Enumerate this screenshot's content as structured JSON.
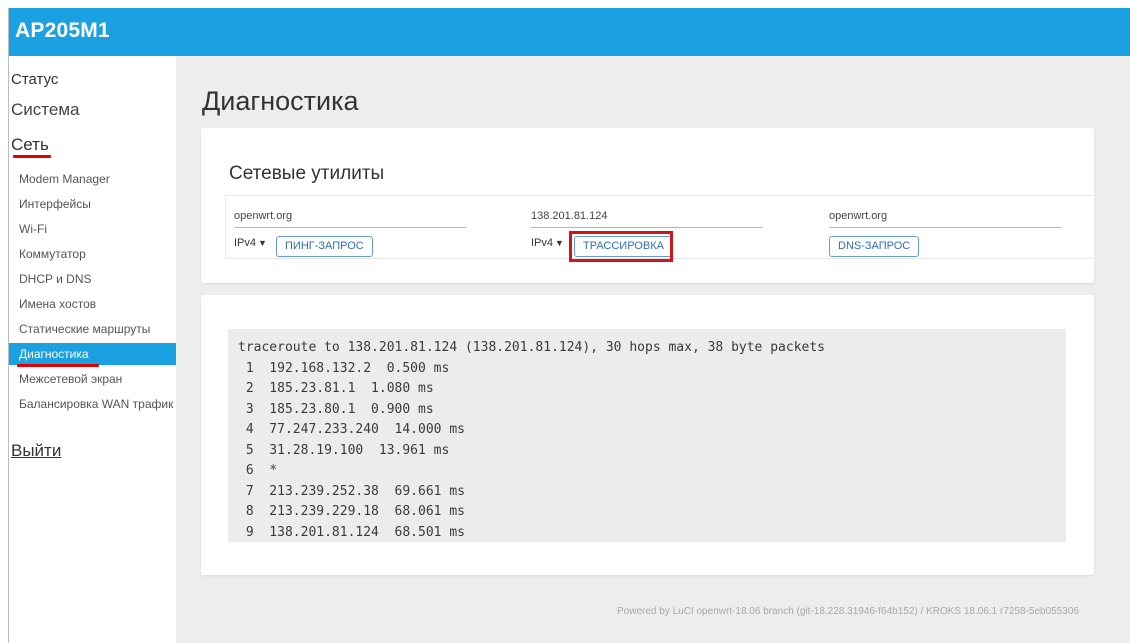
{
  "header": {
    "brand": "AP205M1",
    "accent": "#1ba1e2"
  },
  "sidebar": {
    "status": "Статус",
    "system": "Система",
    "network": "Сеть",
    "items": [
      {
        "label": "Modem Manager"
      },
      {
        "label": "Интерфейсы"
      },
      {
        "label": "Wi-Fi"
      },
      {
        "label": "Коммутатор"
      },
      {
        "label": "DHCP и DNS"
      },
      {
        "label": "Имена хостов"
      },
      {
        "label": "Статические маршруты"
      },
      {
        "label": "Диагностика",
        "active": true
      },
      {
        "label": "Межсетевой экран"
      },
      {
        "label": "Балансировка WAN трафик"
      }
    ],
    "logout": "Выйти"
  },
  "main": {
    "title": "Диагностика",
    "section_title": "Сетевые утилиты",
    "tools": [
      {
        "host": "openwrt.org",
        "proto": "IPv4",
        "button": "ПИНГ-ЗАПРОС"
      },
      {
        "host": "138.201.81.124",
        "proto": "IPv4",
        "button": "ТРАССИРОВКА"
      },
      {
        "host": "openwrt.org",
        "button": "DNS-ЗАПРОС"
      }
    ],
    "output": [
      "traceroute to 138.201.81.124 (138.201.81.124), 30 hops max, 38 byte packets",
      " 1  192.168.132.2  0.500 ms",
      " 2  185.23.81.1  1.080 ms",
      " 3  185.23.80.1  0.900 ms",
      " 4  77.247.233.240  14.000 ms",
      " 5  31.28.19.100  13.961 ms",
      " 6  *",
      " 7  213.239.252.38  69.661 ms",
      " 8  213.239.229.18  68.061 ms",
      " 9  138.201.81.124  68.501 ms"
    ]
  },
  "footer": "Powered by LuCI openwrt-18.06 branch (git-18.228.31946-f64b152) / KROKS 18.06.1 r7258-5eb055306"
}
